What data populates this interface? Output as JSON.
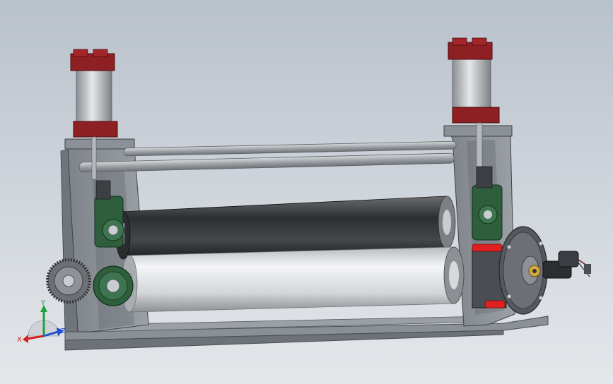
{
  "viewport": {
    "background_top": "#b9c1cb",
    "background_bottom": "#e4e7ea"
  },
  "model": {
    "frame_color": "#8f949a",
    "roller_dark_color": "#3a3c3f",
    "roller_light_color": "#e2e4e6",
    "bearing_color": "#2f5e3c",
    "cylinder_cap_color": "#8e1f22",
    "accent_red": "#e02020"
  },
  "triad": {
    "axis_x": "X",
    "axis_y": "Y",
    "axis_z": "Z",
    "x_color": "#d42020",
    "y_color": "#20a040",
    "z_color": "#2050d0"
  }
}
